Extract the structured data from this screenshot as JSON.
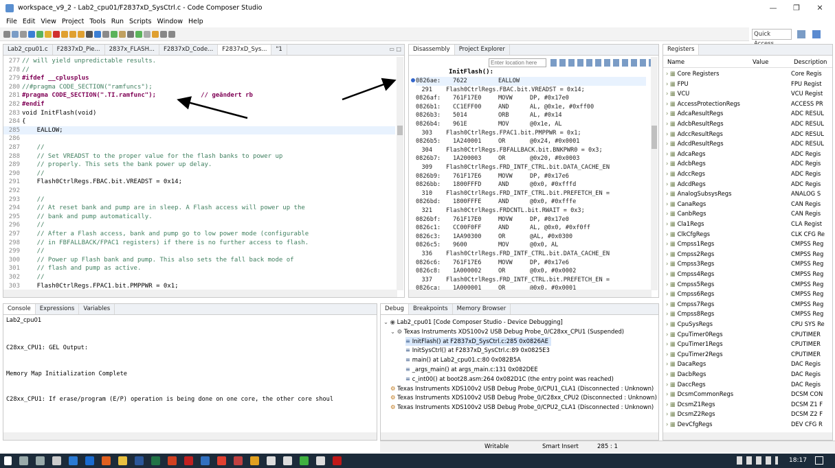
{
  "window": {
    "title": "workspace_v9_2 - Lab2_cpu01/F2837xD_SysCtrl.c - Code Composer Studio"
  },
  "menu": [
    "File",
    "Edit",
    "View",
    "Project",
    "Tools",
    "Run",
    "Scripts",
    "Window",
    "Help"
  ],
  "quick_access": "Quick Access",
  "editor": {
    "tabs": [
      "Lab2_cpu01.c",
      "F2837xD_Pie...",
      "2837x_FLASH...",
      "F2837xD_Code...",
      "F2837xD_Sys...",
      "\"1"
    ],
    "lines": [
      {
        "n": "277",
        "t": "// will yield unpredictable results."
      },
      {
        "n": "278",
        "t": "//"
      },
      {
        "n": "279",
        "t": "#ifdef __cplusplus"
      },
      {
        "n": "280",
        "t": "//#pragma CODE_SECTION(\"ramfuncs\");"
      },
      {
        "n": "281",
        "t": "#pragma CODE_SECTION(\".TI.ramfunc\");            // geändert rb"
      },
      {
        "n": "282",
        "t": "#endif"
      },
      {
        "n": "283",
        "t": "void InitFlash(void)"
      },
      {
        "n": "284",
        "t": "{"
      },
      {
        "n": "285",
        "t": "    EALLOW;"
      },
      {
        "n": "286",
        "t": ""
      },
      {
        "n": "287",
        "t": "    //"
      },
      {
        "n": "288",
        "t": "    // Set VREADST to the proper value for the flash banks to power up"
      },
      {
        "n": "289",
        "t": "    // properly. This sets the bank power up delay."
      },
      {
        "n": "290",
        "t": "    //"
      },
      {
        "n": "291",
        "t": "    Flash0CtrlRegs.FBAC.bit.VREADST = 0x14;"
      },
      {
        "n": "292",
        "t": ""
      },
      {
        "n": "293",
        "t": "    //"
      },
      {
        "n": "294",
        "t": "    // At reset bank and pump are in sleep. A Flash access will power up the"
      },
      {
        "n": "295",
        "t": "    // bank and pump automatically."
      },
      {
        "n": "296",
        "t": "    //"
      },
      {
        "n": "297",
        "t": "    // After a Flash access, bank and pump go to low power mode (configurable"
      },
      {
        "n": "298",
        "t": "    // in FBFALLBACK/FPAC1 registers) if there is no further access to flash."
      },
      {
        "n": "299",
        "t": "    //"
      },
      {
        "n": "300",
        "t": "    // Power up Flash bank and pump. This also sets the fall back mode of"
      },
      {
        "n": "301",
        "t": "    // flash and pump as active."
      },
      {
        "n": "302",
        "t": "    //"
      },
      {
        "n": "303",
        "t": "    Flash0CtrlRegs.FPAC1.bit.PMPPWR = 0x1;"
      }
    ]
  },
  "disassembly": {
    "tabs": [
      "Disassembly",
      "Project Explorer"
    ],
    "location_placeholder": "Enter location here",
    "label": "InitFlash():",
    "rows": [
      {
        "a": "0826ae:",
        "h": "7622",
        "o": "EALLOW",
        "s": ""
      },
      {
        "a": "291",
        "h": "",
        "o": "",
        "s": "Flash0CtrlRegs.FBAC.bit.VREADST = 0x14;"
      },
      {
        "a": "0826af:",
        "h": "761F17E0",
        "o": "MOVW",
        "s": "DP, #0x17e0"
      },
      {
        "a": "0826b1:",
        "h": "CC1EFF00",
        "o": "AND",
        "s": "AL, @0x1e, #0xff00"
      },
      {
        "a": "0826b3:",
        "h": "5014",
        "o": "ORB",
        "s": "AL, #0x14"
      },
      {
        "a": "0826b4:",
        "h": "961E",
        "o": "MOV",
        "s": "@0x1e, AL"
      },
      {
        "a": "303",
        "h": "",
        "o": "",
        "s": "Flash0CtrlRegs.FPAC1.bit.PMPPWR = 0x1;"
      },
      {
        "a": "0826b5:",
        "h": "1A240001",
        "o": "OR",
        "s": "@0x24, #0x0001"
      },
      {
        "a": "304",
        "h": "",
        "o": "",
        "s": "Flash0CtrlRegs.FBFALLBACK.bit.BNKPWR0 = 0x3;"
      },
      {
        "a": "0826b7:",
        "h": "1A200003",
        "o": "OR",
        "s": "@0x20, #0x0003"
      },
      {
        "a": "309",
        "h": "",
        "o": "",
        "s": "Flash0CtrlRegs.FRD_INTF_CTRL.bit.DATA_CACHE_EN"
      },
      {
        "a": "0826b9:",
        "h": "761F17E6",
        "o": "MOVW",
        "s": "DP, #0x17e6"
      },
      {
        "a": "0826bb:",
        "h": "1800FFFD",
        "o": "AND",
        "s": "@0x0, #0xfffd"
      },
      {
        "a": "310",
        "h": "",
        "o": "",
        "s": "Flash0CtrlRegs.FRD_INTF_CTRL.bit.PREFETCH_EN ="
      },
      {
        "a": "0826bd:",
        "h": "1800FFFE",
        "o": "AND",
        "s": "@0x0, #0xfffe"
      },
      {
        "a": "321",
        "h": "",
        "o": "",
        "s": "Flash0CtrlRegs.FRDCNTL.bit.RWAIT = 0x3;"
      },
      {
        "a": "0826bf:",
        "h": "761F17E0",
        "o": "MOVW",
        "s": "DP, #0x17e0"
      },
      {
        "a": "0826c1:",
        "h": "CC00F0FF",
        "o": "AND",
        "s": "AL, @0x0, #0xf0ff"
      },
      {
        "a": "0826c3:",
        "h": "1AA90300",
        "o": "OR",
        "s": "@AL, #0x0300"
      },
      {
        "a": "0826c5:",
        "h": "9600",
        "o": "MOV",
        "s": "@0x0, AL"
      },
      {
        "a": "336",
        "h": "",
        "o": "",
        "s": "Flash0CtrlRegs.FRD_INTF_CTRL.bit.DATA_CACHE_EN"
      },
      {
        "a": "0826c6:",
        "h": "761F17E6",
        "o": "MOVW",
        "s": "DP, #0x17e6"
      },
      {
        "a": "0826c8:",
        "h": "1A000002",
        "o": "OR",
        "s": "@0x0, #0x0002"
      },
      {
        "a": "337",
        "h": "",
        "o": "",
        "s": "Flash0CtrlRegs.FRD_INTF_CTRL.bit.PREFETCH_EN ="
      },
      {
        "a": "0826ca:",
        "h": "1A000001",
        "o": "OR",
        "s": "@0x0, #0x0001"
      }
    ]
  },
  "registers": {
    "tab": "Registers",
    "cols": [
      "Name",
      "Value",
      "Description"
    ],
    "rows": [
      {
        "n": "Core Registers",
        "d": "Core Regis"
      },
      {
        "n": "FPU",
        "d": "FPU Regist"
      },
      {
        "n": "VCU",
        "d": "VCU Regist"
      },
      {
        "n": "AccessProtectionRegs",
        "d": "ACCESS PR"
      },
      {
        "n": "AdcaResultRegs",
        "d": "ADC RESUL"
      },
      {
        "n": "AdcbResultRegs",
        "d": "ADC RESUL"
      },
      {
        "n": "AdccResultRegs",
        "d": "ADC RESUL"
      },
      {
        "n": "AdcdResultRegs",
        "d": "ADC RESUL"
      },
      {
        "n": "AdcaRegs",
        "d": "ADC Regis"
      },
      {
        "n": "AdcbRegs",
        "d": "ADC Regis"
      },
      {
        "n": "AdccRegs",
        "d": "ADC Regis"
      },
      {
        "n": "AdcdRegs",
        "d": "ADC Regis"
      },
      {
        "n": "AnalogSubsysRegs",
        "d": "ANALOG S"
      },
      {
        "n": "CanaRegs",
        "d": "CAN Regis"
      },
      {
        "n": "CanbRegs",
        "d": "CAN Regis"
      },
      {
        "n": "Cla1Regs",
        "d": "CLA Regist"
      },
      {
        "n": "ClkCfgRegs",
        "d": "CLK CFG Re"
      },
      {
        "n": "Cmpss1Regs",
        "d": "CMPSS Reg"
      },
      {
        "n": "Cmpss2Regs",
        "d": "CMPSS Reg"
      },
      {
        "n": "Cmpss3Regs",
        "d": "CMPSS Reg"
      },
      {
        "n": "Cmpss4Regs",
        "d": "CMPSS Reg"
      },
      {
        "n": "Cmpss5Regs",
        "d": "CMPSS Reg"
      },
      {
        "n": "Cmpss6Regs",
        "d": "CMPSS Reg"
      },
      {
        "n": "Cmpss7Regs",
        "d": "CMPSS Reg"
      },
      {
        "n": "Cmpss8Regs",
        "d": "CMPSS Reg"
      },
      {
        "n": "CpuSysRegs",
        "d": "CPU SYS Re"
      },
      {
        "n": "CpuTimer0Regs",
        "d": "CPUTIMER"
      },
      {
        "n": "CpuTimer1Regs",
        "d": "CPUTIMER"
      },
      {
        "n": "CpuTimer2Regs",
        "d": "CPUTIMER"
      },
      {
        "n": "DacaRegs",
        "d": "DAC Regis"
      },
      {
        "n": "DacbRegs",
        "d": "DAC Regis"
      },
      {
        "n": "DaccRegs",
        "d": "DAC Regis"
      },
      {
        "n": "DcsmCommonRegs",
        "d": "DCSM CON"
      },
      {
        "n": "DcsmZ1Regs",
        "d": "DCSM Z1 F"
      },
      {
        "n": "DcsmZ2Regs",
        "d": "DCSM Z2 F"
      },
      {
        "n": "DevCfgRegs",
        "d": "DEV CFG R"
      }
    ]
  },
  "console": {
    "tabs": [
      "Console",
      "Expressions",
      "Variables"
    ],
    "project": "Lab2_cpu01",
    "lines": [
      "C28xx_CPU1: GEL Output:",
      "Memory Map Initialization Complete",
      "C28xx_CPU1: If erase/program (E/P) operation is being done on one core, the other core shoul"
    ]
  },
  "debug": {
    "tabs": [
      "Debug",
      "Breakpoints",
      "Memory Browser"
    ],
    "items": [
      "Lab2_cpu01 [Code Composer Studio - Device Debugging]",
      "Texas Instruments XDS100v2 USB Debug Probe_0/C28xx_CPU1 (Suspended)",
      "InitFlash() at F2837xD_SysCtrl.c:285 0x0826AE",
      "InitSysCtrl() at F2837xD_SysCtrl.c:89 0x0825E3",
      "main() at Lab2_cpu01.c:80 0x082B5A",
      "_args_main() at args_main.c:131 0x082DEE",
      "c_int00() at boot28.asm:264 0x082D1C  (the entry point was reached)",
      "Texas Instruments XDS100v2 USB Debug Probe_0/CPU1_CLA1 (Disconnected : Unknown)",
      "Texas Instruments XDS100v2 USB Debug Probe_0/C28xx_CPU2 (Disconnected : Unknown)",
      "Texas Instruments XDS100v2 USB Debug Probe_0/CPU2_CLA1 (Disconnected : Unknown)"
    ]
  },
  "status": {
    "writable": "Writable",
    "insert": "Smart Insert",
    "position": "285 : 1"
  },
  "taskbar": {
    "time": "18:17"
  },
  "colors": {
    "accent": "#3366cc",
    "taskbar": "#1c2b3a",
    "current_line": "#e8f2fe"
  }
}
